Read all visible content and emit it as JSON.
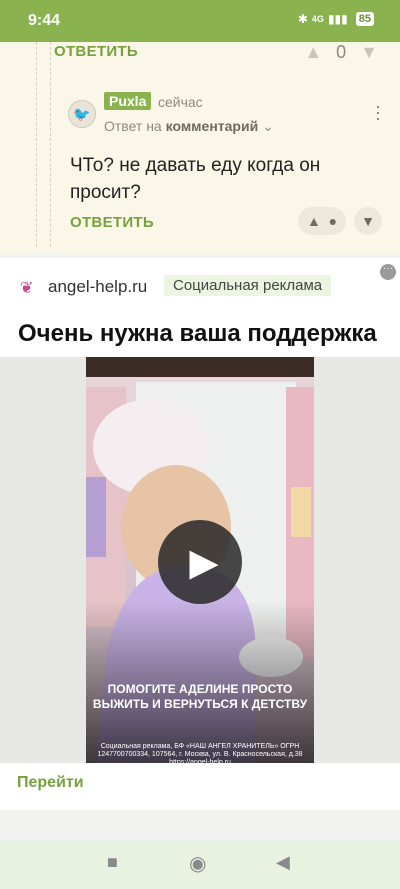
{
  "status": {
    "time": "9:44",
    "network": "4G",
    "battery": "85"
  },
  "comments": {
    "previous_reply_label": "ОТВЕТИТЬ",
    "previous_score": "0",
    "reply": {
      "username": "Puxla",
      "time": "сейчас",
      "reply_to_prefix": "Ответ на",
      "reply_to_target": "комментарий",
      "text": "ЧТо? не давать еду когда он просит?",
      "reply_label": "ОТВЕТИТЬ"
    }
  },
  "ad": {
    "domain": "angel-help.ru",
    "badge": "Социальная реклама",
    "title": "Очень нужна ваша поддержка",
    "video_caption": "ПОМОГИТЕ АДЕЛИНЕ ПРОСТО ВЫЖИТЬ И ВЕРНУТЬСЯ К ДЕТСТВУ",
    "video_disclaimer": "Социальная реклама, БФ «НАШ АНГЕЛ ХРАНИТЕЛЬ» ОГРН 1247700700334, 107564, г. Москва, ул. В. Красносельская, д.38 https://angel-help.ru",
    "cta": "Перейти"
  },
  "icons": {
    "upvote": "triangle-up-icon",
    "downvote": "triangle-down-icon",
    "kebab": "kebab-menu-icon",
    "play": "play-icon"
  },
  "colors": {
    "accent": "#8ab34f",
    "link": "#77a03f",
    "comment_bg": "#faf7e9"
  }
}
